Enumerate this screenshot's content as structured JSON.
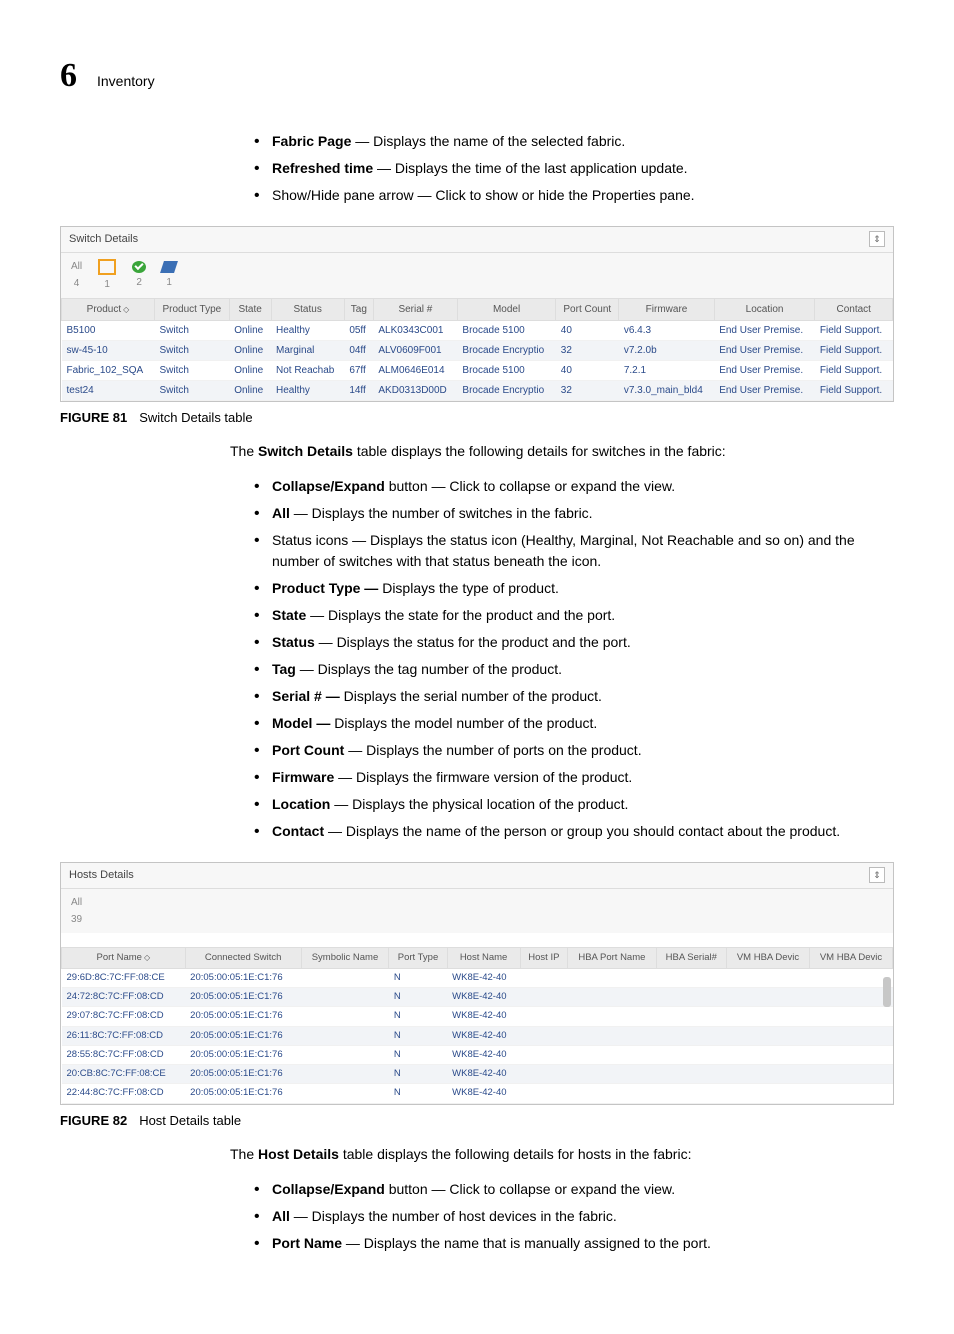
{
  "header": {
    "chapter": "6",
    "title": "Inventory"
  },
  "introList": [
    {
      "b": "Fabric Page",
      "t": " — Displays the name of the selected fabric."
    },
    {
      "b": "Refreshed time",
      "t": " — Displays the time of the last application update."
    },
    {
      "b": "",
      "t": "Show/Hide pane arrow — Click to show or hide the Properties pane."
    }
  ],
  "switchPanel": {
    "title": "Switch Details",
    "status": {
      "allLabel": "All",
      "allCount": "4",
      "orange": "1",
      "green": "2",
      "blue": "1"
    },
    "columns": [
      "Product",
      "Product Type",
      "State",
      "Status",
      "Tag",
      "Serial #",
      "Model",
      "Port Count",
      "Firmware",
      "Location",
      "Contact"
    ],
    "rows": [
      [
        "B5100",
        "Switch",
        "Online",
        "Healthy",
        "05ff",
        "ALK0343C001",
        "Brocade 5100",
        "40",
        "v6.4.3",
        "End User Premise.",
        "Field Support."
      ],
      [
        "sw-45-10",
        "Switch",
        "Online",
        "Marginal",
        "04ff",
        "ALV0609F001",
        "Brocade Encryptio",
        "32",
        "v7.2.0b",
        "End User Premise.",
        "Field Support."
      ],
      [
        "Fabric_102_SQA",
        "Switch",
        "Online",
        "Not Reachab",
        "67ff",
        "ALM0646E014",
        "Brocade 5100",
        "40",
        "7.2.1",
        "End User Premise.",
        "Field Support."
      ],
      [
        "test24",
        "Switch",
        "Online",
        "Healthy",
        "14ff",
        "AKD0313D00D",
        "Brocade Encryptio",
        "32",
        "v7.3.0_main_bld4",
        "End User Premise.",
        "Field Support."
      ]
    ]
  },
  "fig81": {
    "label": "FIGURE 81",
    "caption": "Switch Details table"
  },
  "switchIntro": {
    "pre": "The ",
    "b": "Switch Details",
    "post": " table displays the following details for switches in the fabric:"
  },
  "switchList": [
    {
      "b": "Collapse/Expand",
      "t": " button — Click to collapse or expand the view."
    },
    {
      "b": "All",
      "t": " — Displays the number of switches in the fabric."
    },
    {
      "b": "",
      "t": "Status icons — Displays the status icon (Healthy, Marginal, Not Reachable and so on) and the number of switches with that status beneath the icon."
    },
    {
      "b": "Product Type — ",
      "t": "Displays the type of product."
    },
    {
      "b": "State",
      "t": " — Displays the state for the product and the port."
    },
    {
      "b": "Status",
      "t": " — Displays the status for the product and the port."
    },
    {
      "b": "Tag",
      "t": " — Displays the tag number of the product."
    },
    {
      "b": "Serial # — ",
      "t": "Displays the serial number of the product."
    },
    {
      "b": "Model — ",
      "t": "Displays the model number of the product."
    },
    {
      "b": "Port Count",
      "t": " — Displays the number of ports on the product."
    },
    {
      "b": "Firmware",
      "t": " — Displays the firmware version of the product."
    },
    {
      "b": "Location",
      "t": " — Displays the physical location of the product."
    },
    {
      "b": "Contact",
      "t": " — Displays the name of the person or group you should contact about the product."
    }
  ],
  "hostsPanel": {
    "title": "Hosts Details",
    "status": {
      "allLabel": "All",
      "allCount": "39"
    },
    "columns": [
      "Port Name",
      "Connected Switch",
      "Symbolic Name",
      "Port Type",
      "Host Name",
      "Host IP",
      "HBA Port Name",
      "HBA Serial#",
      "VM HBA Devic",
      "VM HBA Devic"
    ],
    "rows": [
      [
        "29:6D:8C:7C:FF:08:CE",
        "20:05:00:05:1E:C1:76",
        "",
        "N",
        "WK8E-42-40",
        "",
        "",
        "",
        "",
        ""
      ],
      [
        "24:72:8C:7C:FF:08:CD",
        "20:05:00:05:1E:C1:76",
        "",
        "N",
        "WK8E-42-40",
        "",
        "",
        "",
        "",
        ""
      ],
      [
        "29:07:8C:7C:FF:08:CD",
        "20:05:00:05:1E:C1:76",
        "",
        "N",
        "WK8E-42-40",
        "",
        "",
        "",
        "",
        ""
      ],
      [
        "26:11:8C:7C:FF:08:CD",
        "20:05:00:05:1E:C1:76",
        "",
        "N",
        "WK8E-42-40",
        "",
        "",
        "",
        "",
        ""
      ],
      [
        "28:55:8C:7C:FF:08:CD",
        "20:05:00:05:1E:C1:76",
        "",
        "N",
        "WK8E-42-40",
        "",
        "",
        "",
        "",
        ""
      ],
      [
        "20:CB:8C:7C:FF:08:CE",
        "20:05:00:05:1E:C1:76",
        "",
        "N",
        "WK8E-42-40",
        "",
        "",
        "",
        "",
        ""
      ],
      [
        "22:44:8C:7C:FF:08:CD",
        "20:05:00:05:1E:C1:76",
        "",
        "N",
        "WK8E-42-40",
        "",
        "",
        "",
        "",
        ""
      ]
    ]
  },
  "fig82": {
    "label": "FIGURE 82",
    "caption": "Host Details table"
  },
  "hostsIntro": {
    "pre": "The ",
    "b": "Host Details",
    "post": " table displays the following details for hosts in the fabric:"
  },
  "hostsList": [
    {
      "b": "Collapse/Expand",
      "t": " button — Click to collapse or expand the view."
    },
    {
      "b": "All",
      "t": " — Displays the number of host devices in the fabric."
    },
    {
      "b": "Port Name",
      "t": " — Displays the name that is manually assigned to the port."
    }
  ]
}
